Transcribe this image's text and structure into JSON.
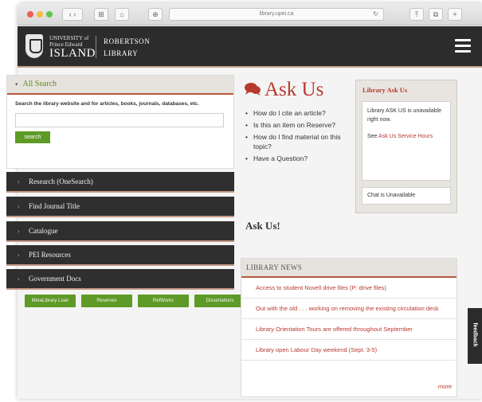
{
  "browser": {
    "url": "library.upei.ca",
    "buttons": [
      "‹ ›",
      "⊞",
      "⌂",
      "⊕",
      "↻",
      "⤒",
      "⧉",
      "+"
    ]
  },
  "header": {
    "university_line": "UNIVERSITY of Prince Edward",
    "island": "ISLAND",
    "library_line1": "ROBERTSON",
    "library_line2": "LIBRARY",
    "colors": {
      "bar": "#2c2c2c",
      "accent": "#b73a2e",
      "green": "#5e9a26"
    }
  },
  "search": {
    "heading": "All Search",
    "description": "Search the library website and for articles, books, journals, databases, etc.",
    "placeholder": "",
    "button": "search"
  },
  "accordion": [
    {
      "label": "Research (OneSearch)"
    },
    {
      "label": "Find Journal Title"
    },
    {
      "label": "Catalogue"
    },
    {
      "label": "PEI Resources"
    },
    {
      "label": "Government Docs"
    }
  ],
  "quick_links": [
    "MetaLibrary Loan",
    "Reserves",
    "RefWorks",
    "Dissertations"
  ],
  "ask": {
    "title": "Ask Us",
    "items": [
      "How do I cite an article?",
      "Is this an item on Reserve?",
      "How do I find material on this topic?",
      "Have a Question?"
    ],
    "footer": "Ask Us!"
  },
  "library_ask": {
    "title": "Library Ask Us",
    "status": "Library ASK US is unavailable right now.",
    "see": "See",
    "hours_link": "Ask Us Service Hours",
    "chat": "Chat is Unavailable"
  },
  "news": {
    "heading": "LIBRARY NEWS",
    "items": [
      "Access to student Novell drive files (P: drive files)",
      "Out with the old . . . working on removing the existing circulation desk",
      "Library Orientation Tours are offered throughout September",
      "Library open Labour Day weekend (Sept. 3-5)"
    ],
    "more": "more"
  },
  "feedback": "feedback"
}
